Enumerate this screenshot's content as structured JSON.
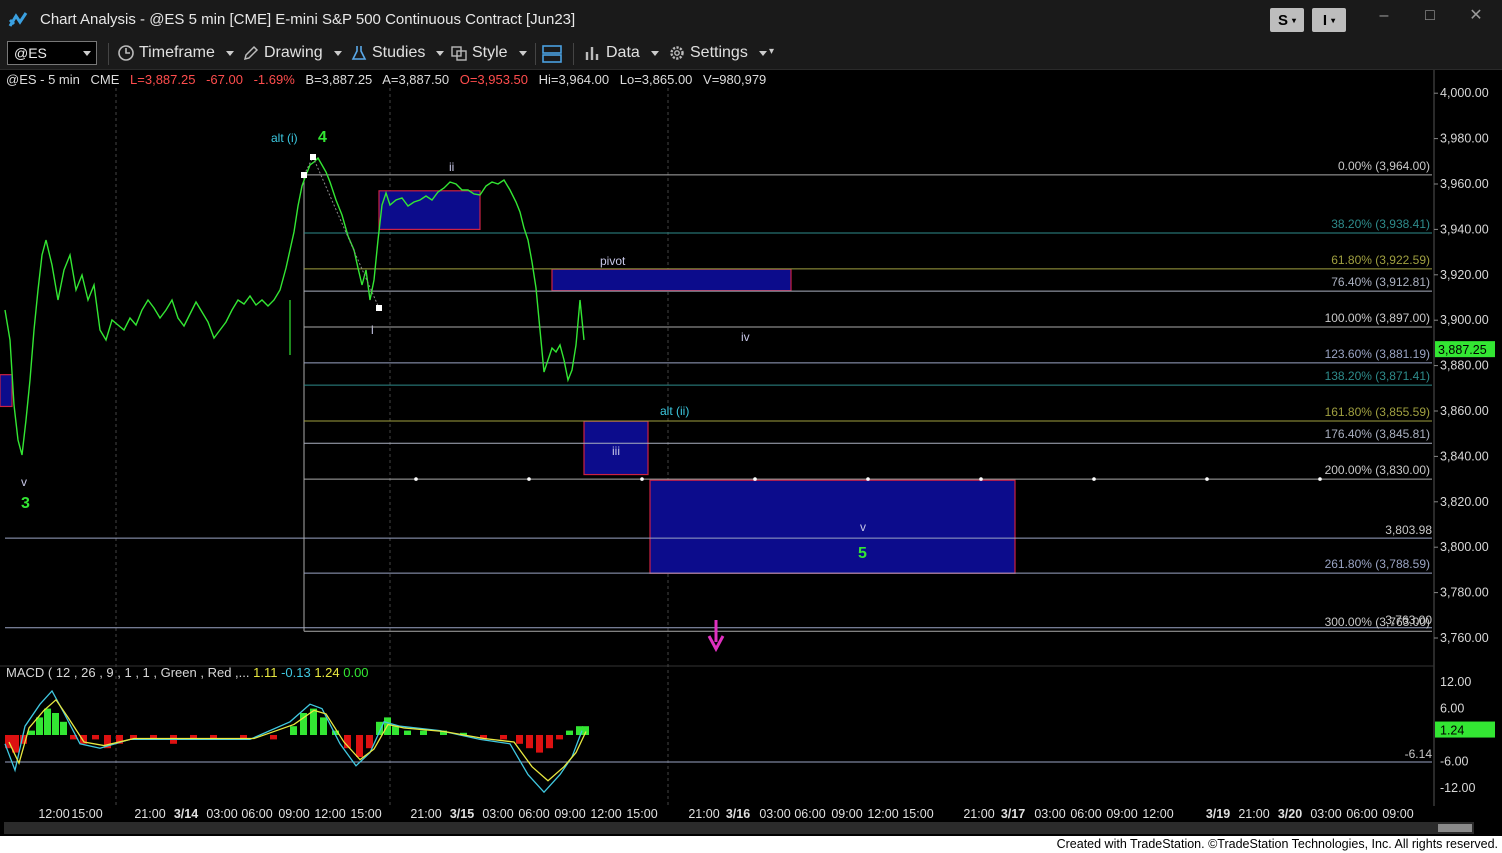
{
  "window": {
    "title": "Chart Analysis - @ES 5 min [CME] E-mini S&P 500 Continuous Contract [Jun23]",
    "btn_s": "S",
    "btn_i": "I",
    "minimize": "–",
    "maximize": "□",
    "close": "✕"
  },
  "toolbar": {
    "symbol": "@ES",
    "timeframe": "Timeframe",
    "drawing": "Drawing",
    "studies": "Studies",
    "style": "Style",
    "data": "Data",
    "settings": "Settings"
  },
  "info": {
    "symbol": "@ES - 5 min",
    "exchange": "CME",
    "last": "L=3,887.25",
    "change": "-67.00",
    "pct": "-1.69%",
    "bid": "B=3,887.25",
    "ask": "A=3,887.50",
    "open": "O=3,953.50",
    "high": "Hi=3,964.00",
    "low": "Lo=3,865.00",
    "volume": "V=980,979"
  },
  "macd": {
    "label": "MACD ( 12 , 26 , 9 , 1 , 1 , Green , Red ,...",
    "v1": "1.11",
    "v2": "-0.13",
    "v3": "1.24",
    "v4": "0.00",
    "ticks": [
      "12.00",
      "6.00",
      "-6.00",
      "-12.00"
    ],
    "current": "1.24",
    "hline_label": "-6.14"
  },
  "price_axis": {
    "ticks": [
      "4,000.00",
      "3,980.00",
      "3,960.00",
      "3,940.00",
      "3,920.00",
      "3,900.00",
      "3,880.00",
      "3,860.00",
      "3,840.00",
      "3,820.00",
      "3,800.00",
      "3,780.00",
      "3,760.00"
    ],
    "last_price": "3,887.25"
  },
  "fib_levels": [
    {
      "label": "0.00% (3,964.00)",
      "price": 3964.0,
      "color": "#aaaaaa"
    },
    {
      "label": "38.20% (3,938.41)",
      "price": 3938.41,
      "color": "#2e8b8b"
    },
    {
      "label": "61.80% (3,922.59)",
      "price": 3922.59,
      "color": "#a0a040"
    },
    {
      "label": "76.40% (3,912.81)",
      "price": 3912.81,
      "color": "#aab0c0"
    },
    {
      "label": "100.00% (3,897.00)",
      "price": 3897.0,
      "color": "#aaaaaa"
    },
    {
      "label": "123.60% (3,881.19)",
      "price": 3881.19,
      "color": "#9aa4c4"
    },
    {
      "label": "138.20% (3,871.41)",
      "price": 3871.41,
      "color": "#2e8b8b"
    },
    {
      "label": "161.80% (3,855.59)",
      "price": 3855.59,
      "color": "#a0a040"
    },
    {
      "label": "176.40% (3,845.81)",
      "price": 3845.81,
      "color": "#aab0c0"
    },
    {
      "label": "200.00% (3,830.00)",
      "price": 3830.0,
      "color": "#aaaaaa"
    },
    {
      "label": "261.80% (3,788.59)",
      "price": 3788.59,
      "color": "#9aa4c4"
    },
    {
      "label": "300.00% (3,763.00)",
      "price": 3763.0,
      "color": "#aaaaaa"
    }
  ],
  "extra_levels": [
    {
      "label": "3,803.98",
      "price": 3803.98
    },
    {
      "label": "3,763.00",
      "price": 3764.5
    }
  ],
  "annotations": {
    "alt_i": "alt (i)",
    "w4": "4",
    "ii": "ii",
    "i": "i",
    "pivot": "pivot",
    "iv": "iv",
    "alt_ii": "alt (ii)",
    "iii": "iii",
    "v_small": "v",
    "w5": "5",
    "v_left": "v",
    "w3": "3"
  },
  "time_axis": [
    "12:00",
    "15:00",
    "21:00",
    "3/14",
    "03:00",
    "06:00",
    "09:00",
    "12:00",
    "15:00",
    "21:00",
    "3/15",
    "03:00",
    "06:00",
    "09:00",
    "12:00",
    "15:00",
    "21:00",
    "3/16",
    "03:00",
    "06:00",
    "09:00",
    "12:00",
    "15:00",
    "21:00",
    "3/17",
    "03:00",
    "06:00",
    "09:00",
    "12:00",
    "3/19",
    "21:00",
    "3/20",
    "03:00",
    "06:00",
    "09:00"
  ],
  "footer": "Created with TradeStation. ©TradeStation Technologies, Inc. All rights reserved.",
  "colors": {
    "price_line": "#33e633",
    "box_fill": "#0c0c8c",
    "box_border": "#cc2244",
    "annotation_cyan": "#3cc8e0",
    "annotation_green": "#33e633",
    "arrow": "#e030c0",
    "macd_pos": "#33e633",
    "macd_neg": "#dd1111"
  }
}
